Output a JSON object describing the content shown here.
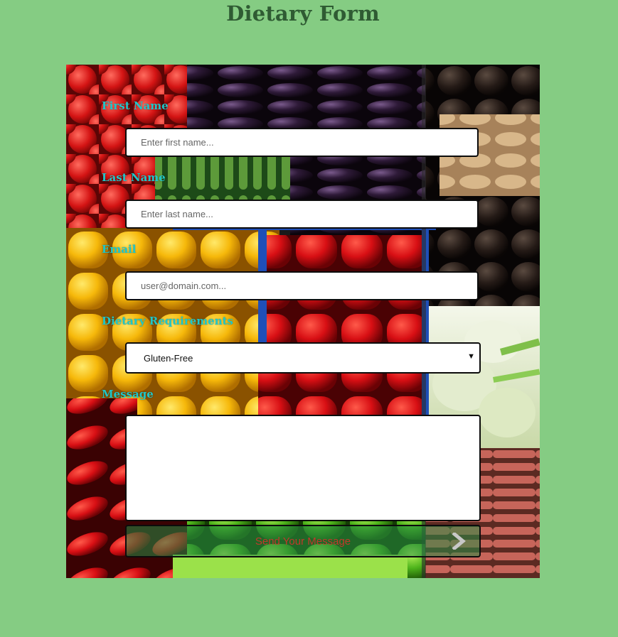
{
  "page": {
    "title": "Dietary Form"
  },
  "form": {
    "first_name": {
      "label": "First Name",
      "placeholder": "Enter first name..."
    },
    "last_name": {
      "label": "Last Name",
      "placeholder": "Enter last name..."
    },
    "email": {
      "label": "Email",
      "placeholder": "user@domain.com..."
    },
    "dietary": {
      "label": "Dietary Requirements",
      "selected": "Gluten-Free"
    },
    "message": {
      "label": "Message",
      "value": ""
    },
    "submit": {
      "label": "Send Your Message"
    }
  },
  "icons": {
    "select_caret": "caret-down-icon",
    "submit_arrow": "chevron-right-icon"
  },
  "colors": {
    "page_background": "#85cc83",
    "title": "#2f5b33",
    "label": "#1fc6c9",
    "submit_text": "#c0392b"
  }
}
